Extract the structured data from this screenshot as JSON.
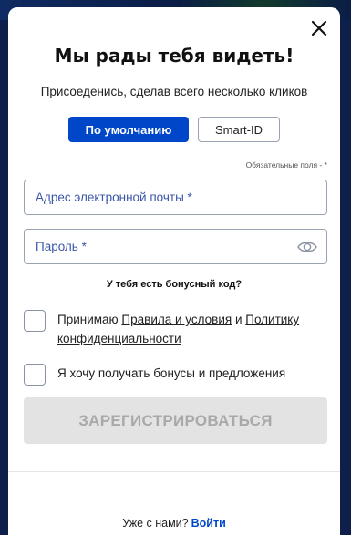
{
  "modal": {
    "title": "Мы рады тебя видеть!",
    "subtitle": "Присоеденись, сделав всего несколько кликов"
  },
  "tabs": [
    {
      "label": "По умолчанию",
      "active": true
    },
    {
      "label": "Smart-ID",
      "active": false
    }
  ],
  "form": {
    "required_note": "Обязательные поля - *",
    "email_placeholder": "Адрес электронной почты *",
    "email_value": "",
    "password_placeholder": "Пароль *",
    "password_value": "",
    "bonus_code_link": "У тебя есть бонусный код?",
    "terms": {
      "prefix": "Принимаю ",
      "terms_link": "Правила и условия",
      "middle": " и ",
      "privacy_link": "Политику конфиденциальности",
      "checked": false
    },
    "bonuses_opt_in": {
      "label": "Я хочу получать бонусы и предложения",
      "checked": false
    },
    "submit_label": "ЗАРЕГИСТРИРОВАТЬСЯ"
  },
  "footer": {
    "prompt": "Уже с нами?",
    "login_link": "Войти"
  },
  "icons": {
    "close": "close-icon",
    "password_visibility": "eye-icon"
  },
  "colors": {
    "accent": "#0046c9",
    "backdrop": "#0d1f4a",
    "disabled_button_bg": "#e3e3e3",
    "disabled_button_text": "#a9a9a9"
  }
}
